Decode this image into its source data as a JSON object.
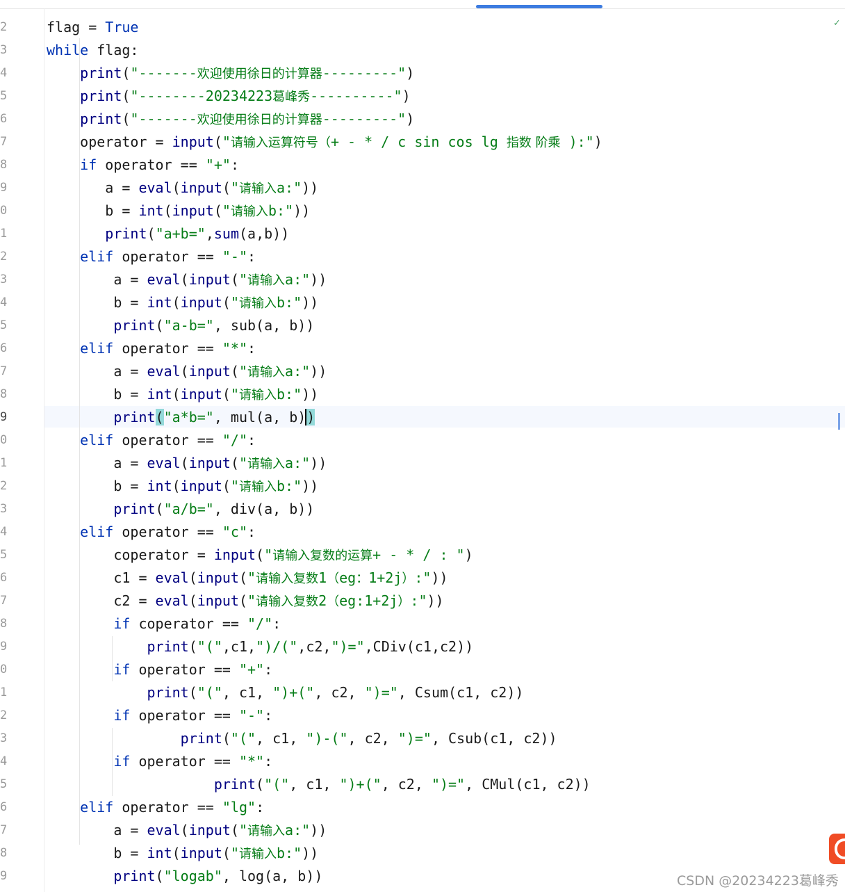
{
  "editor": {
    "lines": [
      {
        "num": "2",
        "tokens": [
          {
            "t": "flag = "
          },
          {
            "t": "True",
            "c": "kw"
          }
        ]
      },
      {
        "num": "3",
        "tokens": [
          {
            "t": "while",
            "c": "kw"
          },
          {
            "t": " flag:"
          }
        ]
      },
      {
        "num": "4",
        "tokens": [
          {
            "t": "    "
          },
          {
            "t": "print",
            "c": "bi"
          },
          {
            "t": "("
          },
          {
            "t": "\"-------",
            "c": "str"
          },
          {
            "t": "欢迎使用徐日的计算器",
            "c": "str cn"
          },
          {
            "t": "---------\"",
            "c": "str"
          },
          {
            "t": ")"
          }
        ]
      },
      {
        "num": "5",
        "tokens": [
          {
            "t": "    "
          },
          {
            "t": "print",
            "c": "bi"
          },
          {
            "t": "("
          },
          {
            "t": "\"--------20234223",
            "c": "str"
          },
          {
            "t": "葛峰秀",
            "c": "str cn"
          },
          {
            "t": "----------\"",
            "c": "str"
          },
          {
            "t": ")"
          }
        ]
      },
      {
        "num": "6",
        "tokens": [
          {
            "t": "    "
          },
          {
            "t": "print",
            "c": "bi"
          },
          {
            "t": "("
          },
          {
            "t": "\"-------",
            "c": "str"
          },
          {
            "t": "欢迎使用徐日的计算器",
            "c": "str cn"
          },
          {
            "t": "---------\"",
            "c": "str"
          },
          {
            "t": ")"
          }
        ]
      },
      {
        "num": "7",
        "tokens": [
          {
            "t": "    operator = "
          },
          {
            "t": "input",
            "c": "bi"
          },
          {
            "t": "("
          },
          {
            "t": "\"",
            "c": "str"
          },
          {
            "t": "请输入运算符号（",
            "c": "str cn"
          },
          {
            "t": "+ - * / c sin cos lg ",
            "c": "str"
          },
          {
            "t": "指数 阶乘",
            "c": "str cn"
          },
          {
            "t": " ):\"",
            "c": "str"
          },
          {
            "t": ")"
          }
        ]
      },
      {
        "num": "8",
        "tokens": [
          {
            "t": "    "
          },
          {
            "t": "if",
            "c": "kw"
          },
          {
            "t": " operator == "
          },
          {
            "t": "\"+\"",
            "c": "str"
          },
          {
            "t": ":"
          }
        ]
      },
      {
        "num": "9",
        "tokens": [
          {
            "t": "       a = "
          },
          {
            "t": "eval",
            "c": "bi"
          },
          {
            "t": "("
          },
          {
            "t": "input",
            "c": "bi"
          },
          {
            "t": "("
          },
          {
            "t": "\"",
            "c": "str"
          },
          {
            "t": "请输入",
            "c": "str cn"
          },
          {
            "t": "a:\"",
            "c": "str"
          },
          {
            "t": "))"
          }
        ]
      },
      {
        "num": "0",
        "tokens": [
          {
            "t": "       b = "
          },
          {
            "t": "int",
            "c": "bi"
          },
          {
            "t": "("
          },
          {
            "t": "input",
            "c": "bi"
          },
          {
            "t": "("
          },
          {
            "t": "\"",
            "c": "str"
          },
          {
            "t": "请输入",
            "c": "str cn"
          },
          {
            "t": "b:\"",
            "c": "str"
          },
          {
            "t": "))"
          }
        ]
      },
      {
        "num": "1",
        "tokens": [
          {
            "t": "       "
          },
          {
            "t": "print",
            "c": "bi"
          },
          {
            "t": "("
          },
          {
            "t": "\"a+b=\"",
            "c": "str"
          },
          {
            "t": ","
          },
          {
            "t": "sum",
            "c": "bi"
          },
          {
            "t": "(a,b))"
          }
        ]
      },
      {
        "num": "2",
        "tokens": [
          {
            "t": "    "
          },
          {
            "t": "elif",
            "c": "kw"
          },
          {
            "t": " operator == "
          },
          {
            "t": "\"-\"",
            "c": "str"
          },
          {
            "t": ":"
          }
        ]
      },
      {
        "num": "3",
        "tokens": [
          {
            "t": "        a = "
          },
          {
            "t": "eval",
            "c": "bi"
          },
          {
            "t": "("
          },
          {
            "t": "input",
            "c": "bi"
          },
          {
            "t": "("
          },
          {
            "t": "\"",
            "c": "str"
          },
          {
            "t": "请输入",
            "c": "str cn"
          },
          {
            "t": "a:\"",
            "c": "str"
          },
          {
            "t": "))"
          }
        ]
      },
      {
        "num": "4",
        "tokens": [
          {
            "t": "        b = "
          },
          {
            "t": "int",
            "c": "bi"
          },
          {
            "t": "("
          },
          {
            "t": "input",
            "c": "bi"
          },
          {
            "t": "("
          },
          {
            "t": "\"",
            "c": "str"
          },
          {
            "t": "请输入",
            "c": "str cn"
          },
          {
            "t": "b:\"",
            "c": "str"
          },
          {
            "t": "))"
          }
        ]
      },
      {
        "num": "5",
        "tokens": [
          {
            "t": "        "
          },
          {
            "t": "print",
            "c": "bi"
          },
          {
            "t": "("
          },
          {
            "t": "\"a-b=\"",
            "c": "str"
          },
          {
            "t": ", sub(a, b))"
          }
        ]
      },
      {
        "num": "6",
        "tokens": [
          {
            "t": "    "
          },
          {
            "t": "elif",
            "c": "kw"
          },
          {
            "t": " operator == "
          },
          {
            "t": "\"*\"",
            "c": "str"
          },
          {
            "t": ":"
          }
        ]
      },
      {
        "num": "7",
        "tokens": [
          {
            "t": "        a = "
          },
          {
            "t": "eval",
            "c": "bi"
          },
          {
            "t": "("
          },
          {
            "t": "input",
            "c": "bi"
          },
          {
            "t": "("
          },
          {
            "t": "\"",
            "c": "str"
          },
          {
            "t": "请输入",
            "c": "str cn"
          },
          {
            "t": "a:\"",
            "c": "str"
          },
          {
            "t": "))"
          }
        ]
      },
      {
        "num": "8",
        "tokens": [
          {
            "t": "        b = "
          },
          {
            "t": "int",
            "c": "bi"
          },
          {
            "t": "("
          },
          {
            "t": "input",
            "c": "bi"
          },
          {
            "t": "("
          },
          {
            "t": "\"",
            "c": "str"
          },
          {
            "t": "请输入",
            "c": "str cn"
          },
          {
            "t": "b:\"",
            "c": "str"
          },
          {
            "t": "))"
          }
        ]
      },
      {
        "num": "9",
        "active": true,
        "tokens": [
          {
            "t": "        "
          },
          {
            "t": "print",
            "c": "bi"
          },
          {
            "t": "(",
            "c": "brace"
          },
          {
            "t": "\"a*b=\"",
            "c": "str"
          },
          {
            "t": ", mul(a, b)"
          },
          {
            "t": ")",
            "c": "brace caret"
          }
        ]
      },
      {
        "num": "0",
        "tokens": [
          {
            "t": "    "
          },
          {
            "t": "elif",
            "c": "kw"
          },
          {
            "t": " operator == "
          },
          {
            "t": "\"/\"",
            "c": "str"
          },
          {
            "t": ":"
          }
        ]
      },
      {
        "num": "1",
        "tokens": [
          {
            "t": "        a = "
          },
          {
            "t": "eval",
            "c": "bi"
          },
          {
            "t": "("
          },
          {
            "t": "input",
            "c": "bi"
          },
          {
            "t": "("
          },
          {
            "t": "\"",
            "c": "str"
          },
          {
            "t": "请输入",
            "c": "str cn"
          },
          {
            "t": "a:\"",
            "c": "str"
          },
          {
            "t": "))"
          }
        ]
      },
      {
        "num": "2",
        "tokens": [
          {
            "t": "        b = "
          },
          {
            "t": "int",
            "c": "bi"
          },
          {
            "t": "("
          },
          {
            "t": "input",
            "c": "bi"
          },
          {
            "t": "("
          },
          {
            "t": "\"",
            "c": "str"
          },
          {
            "t": "请输入",
            "c": "str cn"
          },
          {
            "t": "b:\"",
            "c": "str"
          },
          {
            "t": "))"
          }
        ]
      },
      {
        "num": "3",
        "tokens": [
          {
            "t": "        "
          },
          {
            "t": "print",
            "c": "bi"
          },
          {
            "t": "("
          },
          {
            "t": "\"a/b=\"",
            "c": "str"
          },
          {
            "t": ", div(a, b))"
          }
        ]
      },
      {
        "num": "4",
        "tokens": [
          {
            "t": "    "
          },
          {
            "t": "elif",
            "c": "kw"
          },
          {
            "t": " operator == "
          },
          {
            "t": "\"c\"",
            "c": "str"
          },
          {
            "t": ":"
          }
        ]
      },
      {
        "num": "5",
        "tokens": [
          {
            "t": "        coperator = "
          },
          {
            "t": "input",
            "c": "bi"
          },
          {
            "t": "("
          },
          {
            "t": "\"",
            "c": "str"
          },
          {
            "t": "请输入复数的运算",
            "c": "str cn"
          },
          {
            "t": "+ - * / : \"",
            "c": "str"
          },
          {
            "t": ")"
          }
        ]
      },
      {
        "num": "6",
        "tokens": [
          {
            "t": "        c1 = "
          },
          {
            "t": "eval",
            "c": "bi"
          },
          {
            "t": "("
          },
          {
            "t": "input",
            "c": "bi"
          },
          {
            "t": "("
          },
          {
            "t": "\"",
            "c": "str"
          },
          {
            "t": "请输入复数",
            "c": "str cn"
          },
          {
            "t": "1",
            "c": "str"
          },
          {
            "t": "（",
            "c": "str cn"
          },
          {
            "t": "eg",
            "c": "str"
          },
          {
            "t": "：",
            "c": "str cn"
          },
          {
            "t": "1+2j",
            "c": "str"
          },
          {
            "t": "）",
            "c": "str cn"
          },
          {
            "t": ":\"",
            "c": "str"
          },
          {
            "t": "))"
          }
        ]
      },
      {
        "num": "7",
        "tokens": [
          {
            "t": "        c2 = "
          },
          {
            "t": "eval",
            "c": "bi"
          },
          {
            "t": "("
          },
          {
            "t": "input",
            "c": "bi"
          },
          {
            "t": "("
          },
          {
            "t": "\"",
            "c": "str"
          },
          {
            "t": "请输入复数",
            "c": "str cn"
          },
          {
            "t": "2",
            "c": "str"
          },
          {
            "t": "（",
            "c": "str cn"
          },
          {
            "t": "eg:1+2j",
            "c": "str"
          },
          {
            "t": "）",
            "c": "str cn"
          },
          {
            "t": ":\"",
            "c": "str"
          },
          {
            "t": "))"
          }
        ]
      },
      {
        "num": "8",
        "tokens": [
          {
            "t": "        "
          },
          {
            "t": "if",
            "c": "kw"
          },
          {
            "t": " coperator == "
          },
          {
            "t": "\"/\"",
            "c": "str"
          },
          {
            "t": ":"
          }
        ]
      },
      {
        "num": "9",
        "tokens": [
          {
            "t": "            "
          },
          {
            "t": "print",
            "c": "bi"
          },
          {
            "t": "("
          },
          {
            "t": "\"(\"",
            "c": "str"
          },
          {
            "t": ",c1,"
          },
          {
            "t": "\")/(\"",
            "c": "str"
          },
          {
            "t": ",c2,"
          },
          {
            "t": "\")=\"",
            "c": "str"
          },
          {
            "t": ",CDiv(c1,c2))"
          }
        ]
      },
      {
        "num": "0",
        "tokens": [
          {
            "t": "        "
          },
          {
            "t": "if",
            "c": "kw"
          },
          {
            "t": " operator == "
          },
          {
            "t": "\"+\"",
            "c": "str"
          },
          {
            "t": ":"
          }
        ]
      },
      {
        "num": "1",
        "tokens": [
          {
            "t": "            "
          },
          {
            "t": "print",
            "c": "bi"
          },
          {
            "t": "("
          },
          {
            "t": "\"(\"",
            "c": "str"
          },
          {
            "t": ", c1, "
          },
          {
            "t": "\")+(\"",
            "c": "str"
          },
          {
            "t": ", c2, "
          },
          {
            "t": "\")=\"",
            "c": "str"
          },
          {
            "t": ", Csum(c1, c2))"
          }
        ]
      },
      {
        "num": "2",
        "tokens": [
          {
            "t": "        "
          },
          {
            "t": "if",
            "c": "kw"
          },
          {
            "t": " operator == "
          },
          {
            "t": "\"-\"",
            "c": "str"
          },
          {
            "t": ":"
          }
        ]
      },
      {
        "num": "3",
        "tokens": [
          {
            "t": "                "
          },
          {
            "t": "print",
            "c": "bi"
          },
          {
            "t": "("
          },
          {
            "t": "\"(\"",
            "c": "str"
          },
          {
            "t": ", c1, "
          },
          {
            "t": "\")-(\"",
            "c": "str"
          },
          {
            "t": ", c2, "
          },
          {
            "t": "\")=\"",
            "c": "str"
          },
          {
            "t": ", Csub(c1, c2))"
          }
        ]
      },
      {
        "num": "4",
        "tokens": [
          {
            "t": "        "
          },
          {
            "t": "if",
            "c": "kw"
          },
          {
            "t": " operator == "
          },
          {
            "t": "\"*\"",
            "c": "str"
          },
          {
            "t": ":"
          }
        ]
      },
      {
        "num": "5",
        "tokens": [
          {
            "t": "                    "
          },
          {
            "t": "print",
            "c": "bi"
          },
          {
            "t": "("
          },
          {
            "t": "\"(\"",
            "c": "str"
          },
          {
            "t": ", c1, "
          },
          {
            "t": "\")+(\"",
            "c": "str"
          },
          {
            "t": ", c2, "
          },
          {
            "t": "\")=\"",
            "c": "str"
          },
          {
            "t": ", CMul(c1, c2))"
          }
        ]
      },
      {
        "num": "6",
        "tokens": [
          {
            "t": "    "
          },
          {
            "t": "elif",
            "c": "kw"
          },
          {
            "t": " operator == "
          },
          {
            "t": "\"lg\"",
            "c": "str"
          },
          {
            "t": ":"
          }
        ]
      },
      {
        "num": "7",
        "tokens": [
          {
            "t": "        a = "
          },
          {
            "t": "eval",
            "c": "bi"
          },
          {
            "t": "("
          },
          {
            "t": "input",
            "c": "bi"
          },
          {
            "t": "("
          },
          {
            "t": "\"",
            "c": "str"
          },
          {
            "t": "请输入",
            "c": "str cn"
          },
          {
            "t": "a:\"",
            "c": "str"
          },
          {
            "t": "))"
          }
        ]
      },
      {
        "num": "8",
        "tokens": [
          {
            "t": "        b = "
          },
          {
            "t": "int",
            "c": "bi"
          },
          {
            "t": "("
          },
          {
            "t": "input",
            "c": "bi"
          },
          {
            "t": "("
          },
          {
            "t": "\"",
            "c": "str"
          },
          {
            "t": "请输入",
            "c": "str cn"
          },
          {
            "t": "b:\"",
            "c": "str"
          },
          {
            "t": "))"
          }
        ]
      },
      {
        "num": "9",
        "tokens": [
          {
            "t": "        "
          },
          {
            "t": "print",
            "c": "bi"
          },
          {
            "t": "("
          },
          {
            "t": "\"logab\"",
            "c": "str"
          },
          {
            "t": ", log(a, b))"
          }
        ]
      }
    ]
  },
  "watermark": {
    "text": "CSDN @20234223葛峰秀"
  },
  "icons": {
    "inspection": "check-icon",
    "logo": "csdn-logo"
  },
  "colors": {
    "keyword": "#0033b3",
    "builtin": "#000080",
    "string": "#067d17",
    "accent": "#3c7be0"
  }
}
